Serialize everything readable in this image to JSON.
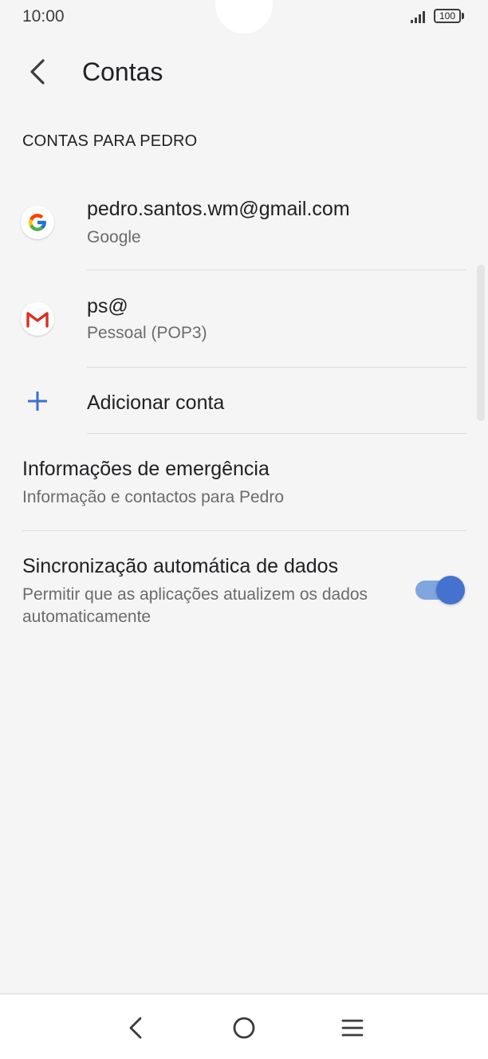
{
  "status_bar": {
    "time": "10:00",
    "battery": "100",
    "signal_icon": "signal-icon"
  },
  "header": {
    "title": "Contas",
    "back_icon": "back-arrow-icon"
  },
  "accounts_section": {
    "header": "CONTAS PARA PEDRO",
    "items": [
      {
        "title": "pedro.santos.wm@gmail.com",
        "subtitle": "Google",
        "icon": "google-icon"
      },
      {
        "title": "ps@",
        "subtitle": "Pessoal (POP3)",
        "icon": "gmail-icon"
      }
    ],
    "add_account": {
      "label": "Adicionar conta",
      "icon": "plus-icon"
    }
  },
  "emergency": {
    "title": "Informações de emergência",
    "subtitle": "Informação e contactos para Pedro"
  },
  "auto_sync": {
    "title": "Sincronização automática de dados",
    "subtitle": "Permitir que as aplicações atualizem os dados automaticamente",
    "enabled": true
  },
  "colors": {
    "background": "#f5f5f5",
    "accent": "#4672cf",
    "accent_track": "#7fa6df",
    "plus": "#3b6fd6",
    "gmail_red": "#d93025"
  },
  "nav_bar": {
    "back_icon": "nav-back-icon",
    "home_icon": "nav-home-icon",
    "menu_icon": "nav-menu-icon"
  }
}
